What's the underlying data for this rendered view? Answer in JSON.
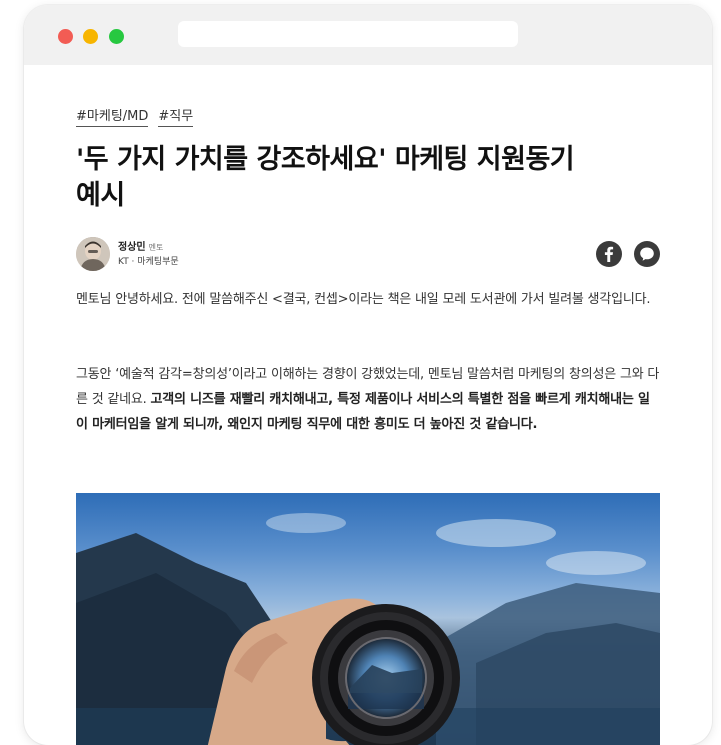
{
  "browser": {
    "dots": [
      "red",
      "yellow",
      "green"
    ]
  },
  "article": {
    "tags": [
      "#마케팅/MD",
      "#직무"
    ],
    "title_line1": "'두 가지 가치를 강조하세요' 마케팅 지원동기",
    "title_line2": "예시",
    "author": {
      "name": "정상민",
      "role": "멘토",
      "org": "KT · 마케팅부문"
    },
    "share": {
      "facebook_icon": "facebook-icon",
      "talk_icon": "speech-bubble-icon"
    },
    "para1": "멘토님 안녕하세요. 전에 말씀해주신 <결국, 컨셉>이라는 책은 내일 모레 도서관에 가서 빌려볼 생각입니다.",
    "para2_normal": "그동안 ‘예술적 감각=창의성’이라고 이해하는 경향이 강했었는데, 멘토님 말씀처럼 마케팅의 창의성은 그와 다른 것 같네요. ",
    "para2_bold": "고객의 니즈를 재빨리 캐치해내고, 특정 제품이나 서비스의 특별한 점을 빠르게 캐치해내는 일이 마케터임을 알게 되니까, 왜인지 마케팅 직무에 대한 흥미도 더 높아진 것 같습니다."
  },
  "colors": {
    "dot_red": "#f25c54",
    "dot_yellow": "#f7b500",
    "dot_green": "#27c840",
    "icon_dark": "#3b3b3b"
  }
}
